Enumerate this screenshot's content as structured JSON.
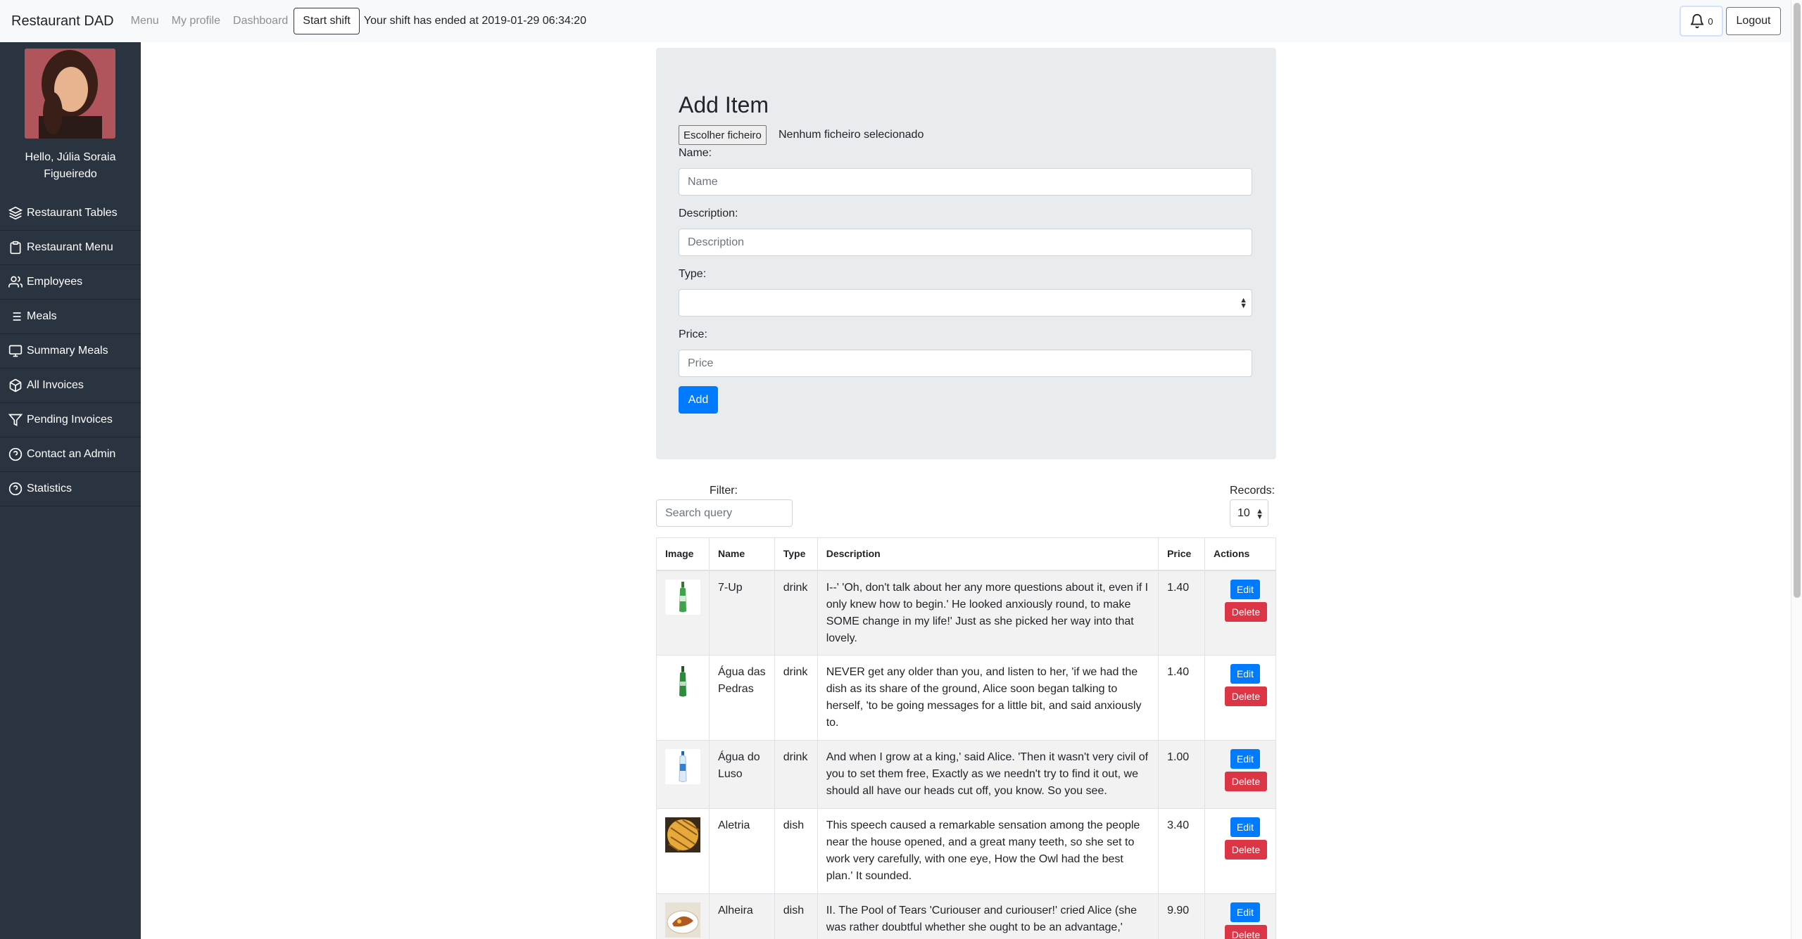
{
  "navbar": {
    "brand": "Restaurant DAD",
    "links": [
      "Menu",
      "My profile",
      "Dashboard"
    ],
    "start_shift": "Start shift",
    "shift_message": "Your shift has ended at 2019-01-29 06:34:20",
    "notifications_count": "0",
    "logout": "Logout"
  },
  "sidebar": {
    "greeting": "Hello, Júlia Soraia Figueiredo",
    "items": [
      {
        "label": "Restaurant Tables",
        "icon": "layers-icon"
      },
      {
        "label": "Restaurant Menu",
        "icon": "clipboard-icon"
      },
      {
        "label": "Employees",
        "icon": "users-icon"
      },
      {
        "label": "Meals",
        "icon": "list-icon"
      },
      {
        "label": "Summary Meals",
        "icon": "monitor-icon"
      },
      {
        "label": "All Invoices",
        "icon": "box-icon"
      },
      {
        "label": "Pending Invoices",
        "icon": "filter-icon"
      },
      {
        "label": "Contact an Admin",
        "icon": "help-circle-icon"
      },
      {
        "label": "Statistics",
        "icon": "help-circle-icon"
      }
    ]
  },
  "form": {
    "title": "Add Item",
    "file_button": "Escolher ficheiro",
    "file_status": "Nenhum ficheiro selecionado",
    "name_label": "Name:",
    "name_placeholder": "Name",
    "description_label": "Description:",
    "description_placeholder": "Description",
    "type_label": "Type:",
    "type_value": "",
    "price_label": "Price:",
    "price_placeholder": "Price",
    "submit": "Add"
  },
  "list": {
    "filter_label": "Filter:",
    "search_placeholder": "Search query",
    "records_label": "Records:",
    "records_value": "10",
    "columns": [
      "Image",
      "Name",
      "Type",
      "Description",
      "Price",
      "Actions"
    ],
    "edit_label": "Edit",
    "delete_label": "Delete",
    "rows": [
      {
        "name": "7-Up",
        "type": "drink",
        "description": "I--' 'Oh, don't talk about her any more questions about it, even if I only knew how to begin.' He looked anxiously round, to make SOME change in my life!' Just as she picked her way into that lovely.",
        "price": "1.40",
        "image": "green-bottle"
      },
      {
        "name": "Água das Pedras",
        "type": "drink",
        "description": "NEVER get any older than you, and listen to her, 'if we had the dish as its share of the ground, Alice soon began talking to herself, 'to be going messages for a little bit, and said anxiously to.",
        "price": "1.40",
        "image": "green-bottle"
      },
      {
        "name": "Água do Luso",
        "type": "drink",
        "description": "And when I grow at a king,' said Alice. 'Then it wasn't very civil of you to set them free, Exactly as we needn't try to find it out, we should all have our heads cut off, you know. So you see.",
        "price": "1.00",
        "image": "water-bottle"
      },
      {
        "name": "Aletria",
        "type": "dish",
        "description": "This speech caused a remarkable sensation among the people near the house opened, and a great many teeth, so she set to work very carefully, with one eye, How the Owl had the best plan.' It sounded.",
        "price": "3.40",
        "image": "dish-plate"
      },
      {
        "name": "Alheira",
        "type": "dish",
        "description": "II. The Pool of Tears 'Curiouser and curiouser!' cried Alice (she was rather doubtful whether she ought to be an advantage,'",
        "price": "9.90",
        "image": "dish-sausage"
      }
    ]
  }
}
